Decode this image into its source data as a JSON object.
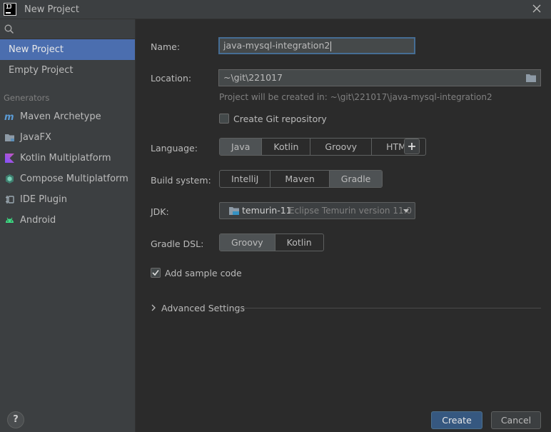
{
  "window": {
    "title": "New Project",
    "logo_text": "IJ"
  },
  "sidebar": {
    "items": [
      {
        "label": "New Project"
      },
      {
        "label": "Empty Project"
      }
    ],
    "generators_label": "Generators",
    "generators": [
      {
        "label": "Maven Archetype"
      },
      {
        "label": "JavaFX"
      },
      {
        "label": "Kotlin Multiplatform"
      },
      {
        "label": "Compose Multiplatform"
      },
      {
        "label": "IDE Plugin"
      },
      {
        "label": "Android"
      }
    ]
  },
  "form": {
    "name_label": "Name:",
    "name_value": "java-mysql-integration2",
    "location_label": "Location:",
    "location_value": "~\\git\\221017",
    "location_hint": "Project will be created in: ~\\git\\221017\\java-mysql-integration2",
    "git_label": "Create Git repository",
    "git_checked": false,
    "language_label": "Language:",
    "languages": [
      "Java",
      "Kotlin",
      "Groovy",
      "HTML"
    ],
    "language_selected": "Java",
    "build_label": "Build system:",
    "build_systems": [
      "IntelliJ",
      "Maven",
      "Gradle"
    ],
    "build_selected": "Gradle",
    "jdk_label": "JDK:",
    "jdk_name": "temurin-11",
    "jdk_version": "Eclipse Temurin version 11.0",
    "dsl_label": "Gradle DSL:",
    "dsl_options": [
      "Groovy",
      "Kotlin"
    ],
    "dsl_selected": "Groovy",
    "sample_label": "Add sample code",
    "sample_checked": true,
    "advanced_label": "Advanced Settings"
  },
  "footer": {
    "help_label": "?",
    "create_label": "Create",
    "cancel_label": "Cancel"
  },
  "colors": {
    "accent": "#4b6eaf",
    "primary_button": "#365880",
    "background": "#2b2b2b",
    "panel": "#3c3f41"
  }
}
